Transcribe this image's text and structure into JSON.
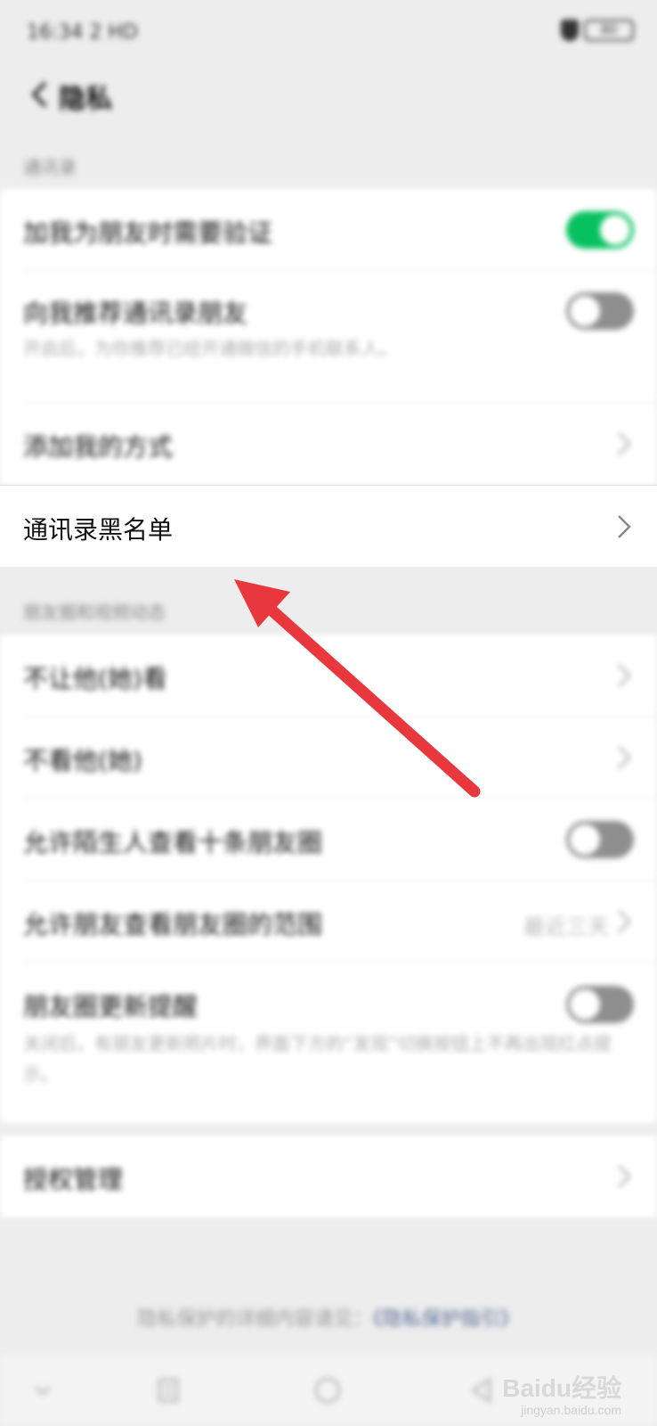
{
  "status": {
    "time": "16:34",
    "network": "2 HD",
    "battery": "80"
  },
  "header": {
    "title": "隐私"
  },
  "sections": {
    "contacts": {
      "label": "通讯录"
    },
    "moments": {
      "label": "朋友圈和视频动态"
    }
  },
  "rows": {
    "verify": {
      "title": "加我为朋友时需要验证",
      "toggle_on": true
    },
    "recommend": {
      "title": "向我推荐通讯录朋友",
      "subtitle": "开启后，为你推荐已经开通微信的手机联系人。",
      "toggle_on": false
    },
    "add_methods": {
      "title": "添加我的方式"
    },
    "blacklist": {
      "title": "通讯录黑名单"
    },
    "hide_from": {
      "title": "不让他(她)看"
    },
    "dont_see": {
      "title": "不看他(她)"
    },
    "stranger_ten": {
      "title": "允许陌生人查看十条朋友圈",
      "toggle_on": false
    },
    "friend_range": {
      "title": "允许朋友查看朋友圈的范围",
      "value": "最近三天"
    },
    "moments_reminder": {
      "title": "朋友圈更新提醒",
      "subtitle": "关闭后，有朋友更新照片时，界面下方的“发现”切换按钮上不再出现红点提示。",
      "toggle_on": false
    },
    "authorization": {
      "title": "授权管理"
    }
  },
  "footer": {
    "text": "隐私保护的详细内容请见：",
    "link": "《隐私保护指引》"
  },
  "watermark": {
    "brand": "Baidu经验",
    "url": "jingyan.baidu.com"
  },
  "colors": {
    "toggle_on": "#07c160",
    "toggle_off": "#8e8e8e",
    "arrow": "#e8383d",
    "link": "#576b95"
  }
}
